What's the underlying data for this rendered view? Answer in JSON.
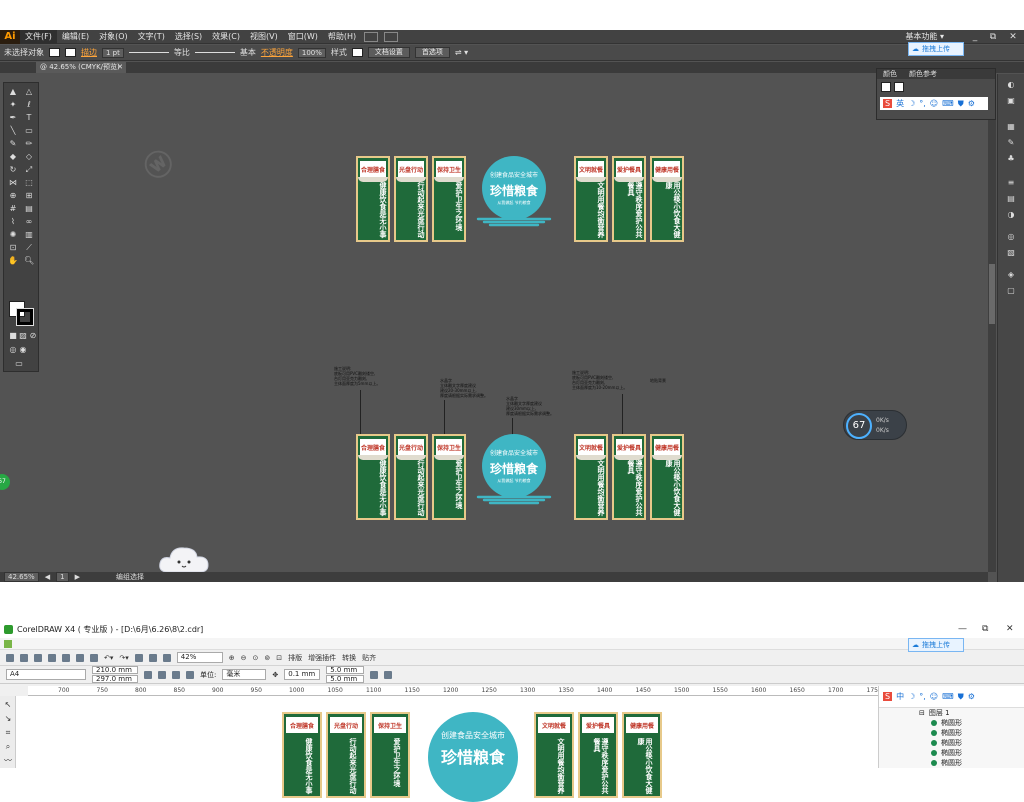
{
  "illustrator": {
    "logo": "Ai",
    "menus": [
      "文件(F)",
      "编辑(E)",
      "对象(O)",
      "文字(T)",
      "选择(S)",
      "效果(C)",
      "视图(V)",
      "窗口(W)",
      "帮助(H)"
    ],
    "workspace": "基本功能",
    "window_controls": [
      "_",
      "⧉",
      "✕"
    ],
    "control_bar": {
      "selection": "未选择对象",
      "stroke_label": "描边",
      "stroke_weight": "1 pt",
      "profile": "等比",
      "brush": "基本",
      "opacity_label": "不透明度",
      "opacity": "100%",
      "style_label": "样式",
      "doc_setup": "文档设置",
      "preferences": "首选项"
    },
    "cloud_upload": "拖拽上传",
    "doc_tab": "@ 42.65% (CMYK/预览)",
    "status_zoom": "42.65%",
    "status_page": "1",
    "status_mode": "编组选择",
    "color_panel": {
      "tabs": [
        "颜色",
        "颜色参考"
      ],
      "ime_label": "英"
    },
    "speed_widget": {
      "percent": "67",
      "lines": [
        "0K/s",
        "0K/s"
      ]
    },
    "green_badge": "67"
  },
  "design": {
    "standees_left": [
      {
        "title": "合理膳食",
        "body": "健康饮食是无小事"
      },
      {
        "title": "光盘行动",
        "body": "行动起来光盘行动"
      },
      {
        "title": "保持卫生",
        "body": "爱护卫生之环境"
      }
    ],
    "standees_right": [
      {
        "title": "文明就餐",
        "body": "文明用餐均衡营养"
      },
      {
        "title": "爱护餐具",
        "body": "遵守秩序爱护公共餐具"
      },
      {
        "title": "健康用餐",
        "body": "用公筷小饮食大健康"
      }
    ],
    "badge": {
      "top": "创建食品安全城市",
      "main": "珍惜粮食",
      "sub": "从我做起 节约粮食"
    },
    "notes": [
      "施工说明:\n底板可用PVC雕刻镂空,\n台灯用亚克力雕刻,\n主体面厚度为5mm以上。",
      "水晶字\n立体雕文字厚度建议\n建议20-30mm以上,\n厚度请根据实际需求调整。",
      "水晶字\n立体雕文字厚度建议\n建议30mm以上,\n厚度请根据实际需求调整。",
      "施工说明:\n底板可用PVC雕刻镂空,\n台灯用亚克力雕刻,\n主体面厚度为10-20mm以上。",
      "地贴背景"
    ]
  },
  "coreldraw": {
    "title": "CorelDRAW X4 ( 专业版 ) - [D:\\6月\\6.26\\8\\2.cdr]",
    "window_controls": [
      "—",
      "⧉",
      "✕"
    ],
    "cloud_upload": "拖拽上传",
    "zoom": "42%",
    "toolbar_items": [
      "排版",
      "增强插件",
      "转换",
      "贴齐"
    ],
    "page_size": "A4",
    "width": "210.0 mm",
    "height": "297.0 mm",
    "units_label": "单位:",
    "units": "毫米",
    "nudge": "0.1 mm",
    "dup_x": "5.0 mm",
    "dup_y": "5.0 mm",
    "ruler_ticks": [
      "700",
      "750",
      "800",
      "850",
      "900",
      "950",
      "1000",
      "1050",
      "1100",
      "1150",
      "1200",
      "1250",
      "1300",
      "1350",
      "1400",
      "1450",
      "1500",
      "1550",
      "1600",
      "1650",
      "1700",
      "1750"
    ],
    "object_panel": {
      "ime_label": "中",
      "layer": "图层 1",
      "items": [
        "椭圆形",
        "椭圆形",
        "椭圆形",
        "椭圆形",
        "椭圆形",
        "椭圆形"
      ]
    }
  }
}
